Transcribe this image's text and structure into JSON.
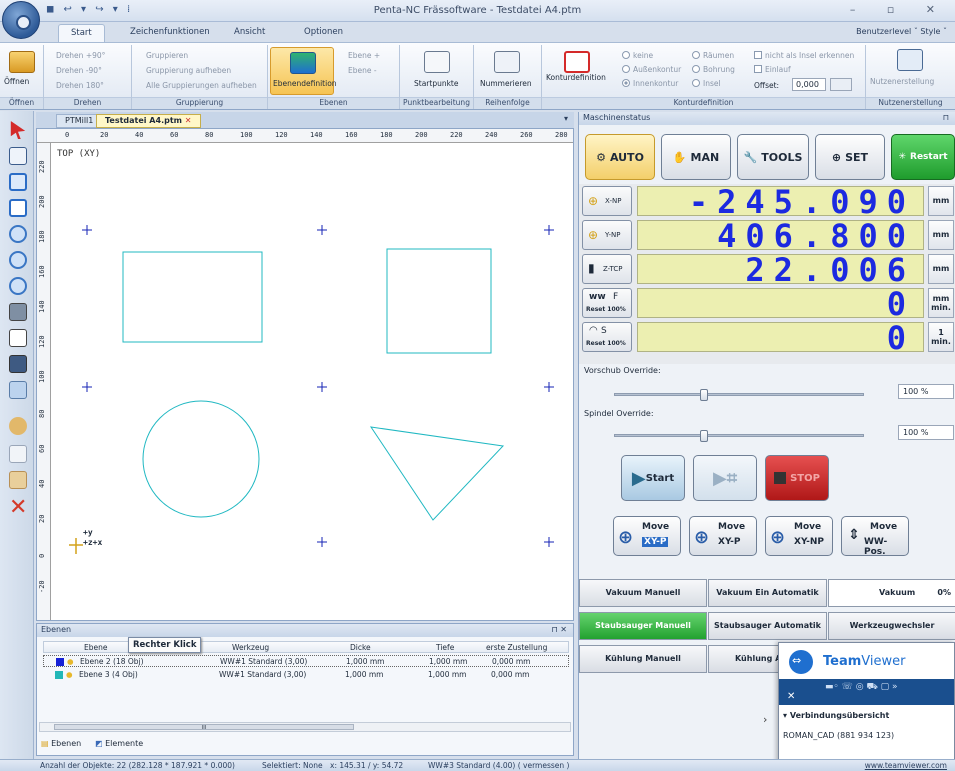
{
  "window": {
    "title": "Penta-NC Frässoftware - Testdatei A4.ptm"
  },
  "quick_access": "◼ ↩ ▾ ↪ ▾ ⁞",
  "window_controls": "– ▫ ✕",
  "menu_tabs": [
    "Start",
    "Zeichenfunktionen",
    "Ansicht",
    "Optionen"
  ],
  "userlevel": "Benutzerlevel ˇ Style ˇ",
  "ribbon": {
    "oeffnen": {
      "btn": "Öffnen",
      "group": "Öffnen"
    },
    "drehen": {
      "items": [
        "Drehen +90°",
        "Drehen -90°",
        "Drehen 180°"
      ],
      "group": "Drehen"
    },
    "gruppierung": {
      "items": [
        "Gruppieren",
        "Gruppierung aufheben",
        "Alle Gruppierungen aufheben"
      ],
      "group": "Gruppierung"
    },
    "ebenen": {
      "main": "Ebenendefinition",
      "items": [
        "Ebene +",
        "Ebene -"
      ],
      "group": "Ebenen"
    },
    "punkt": {
      "btn": "Startpunkte",
      "group": "Punktbearbeitung"
    },
    "reihen": {
      "btn": "Nummerieren",
      "group": "Reihenfolge"
    },
    "kontur": {
      "btn": "Konturdefinition",
      "radios": [
        "keine",
        "Außenkontur",
        "Innenkontur",
        "Räumen",
        "Bohrung",
        "Insel"
      ],
      "checks": [
        "nicht als Insel erkennen",
        "Einlauf"
      ],
      "offset_label": "Offset:",
      "offset_value": "0,000",
      "group": "Konturdefinition"
    },
    "nutzen": {
      "btn": "Nutzenerstellung",
      "group": "Nutzenerstellung"
    }
  },
  "doc_tabs": [
    "PTMill1",
    "Testdatei A4.ptm"
  ],
  "canvas": {
    "view_label": "TOP (XY)",
    "ruler_h": [
      "0",
      "20",
      "40",
      "60",
      "80",
      "100",
      "120",
      "140",
      "160",
      "180",
      "200",
      "220",
      "240",
      "260",
      "280"
    ],
    "ruler_v": [
      "220",
      "200",
      "180",
      "160",
      "140",
      "120",
      "100",
      "80",
      "60",
      "40",
      "20",
      "0",
      "-20"
    ],
    "origin_y": "+y",
    "origin_x": "+z+x"
  },
  "ebenen_panel": {
    "title": "Ebenen",
    "pin": "⊓ ✕",
    "columns": [
      "Ebene",
      "Werkzeug",
      "Dicke",
      "Tiefe",
      "erste Zustellung"
    ],
    "rows": [
      {
        "name": "Ebene 2 (18 Obj)",
        "tool": "WW#1 Standard (3,00)",
        "dicke": "1,000 mm",
        "tiefe": "1,000 mm",
        "zust": "0,000 mm",
        "color": "#1520d6"
      },
      {
        "name": "Ebene 3 (4 Obj)",
        "tool": "WW#1 Standard (3,00)",
        "dicke": "1,000 mm",
        "tiefe": "1,000 mm",
        "zust": "0,000 mm",
        "color": "#22b7b7"
      }
    ],
    "tabs": [
      "Ebenen",
      "Elemente"
    ],
    "tooltip": "Rechter Klick",
    "scroll_marker": "III"
  },
  "statusbar": {
    "objekte": "Anzahl der Objekte: 22 (282.128 * 187.921 * 0.000)",
    "selektiert": "Selektiert: None",
    "coords": "x:  145.31 / y:   54.72",
    "werkzeug": "WW#3 Standard (4.00) ( vermessen )",
    "url": "www.teamviewer.com"
  },
  "maschinenstatus": {
    "title": "Maschinenstatus",
    "pin": "⊓",
    "modes": [
      "AUTO",
      "MAN",
      "TOOLS",
      "SET",
      "Restart"
    ],
    "axes": [
      {
        "label": "X-NP",
        "value": "-245.090",
        "unit": "mm"
      },
      {
        "label": "Y-NP",
        "value": "406.800",
        "unit": "mm"
      },
      {
        "label": "Z-TCP",
        "value": "22.006",
        "unit": "mm"
      },
      {
        "label": "F",
        "sub": "Reset 100%",
        "value": "0",
        "unit": "mm\nmin."
      },
      {
        "label": "S",
        "sub": "Reset 100%",
        "value": "0",
        "unit": "1\nmin."
      }
    ],
    "vorschub_label": "Vorschub Override:",
    "vorschub_value": "100 %",
    "vorschub_fraction": 0.36,
    "spindel_label": "Spindel Override:",
    "spindel_value": "100 %",
    "spindel_fraction": 0.36,
    "start": "Start",
    "stop": "STOP",
    "move_buttons": [
      {
        "l1": "Move",
        "l2": "XY-P"
      },
      {
        "l1": "Move",
        "l2": "XY-P"
      },
      {
        "l1": "Move",
        "l2": "XY-NP"
      },
      {
        "l1": "Move",
        "l2": "WW-Pos."
      }
    ],
    "grid_buttons": [
      "Vakuum Manuell",
      "Vakuum Ein Automatik",
      "Vakuum",
      "0%",
      "Staubsauger Manuell",
      "Staubsauger Automatik",
      "Werkzeugwechsler",
      "Kühlung Manuell",
      "Kühlung Au"
    ]
  },
  "teamviewer": {
    "brand1": "Team",
    "brand2": "Viewer",
    "close": "✕",
    "toolbar_icons": "▬◦ ☏ ◎ ⛟ ▢ »",
    "expand": "›",
    "section": "Verbindungsübersicht",
    "entry": "ROMAN_CAD (881 934 123)"
  }
}
